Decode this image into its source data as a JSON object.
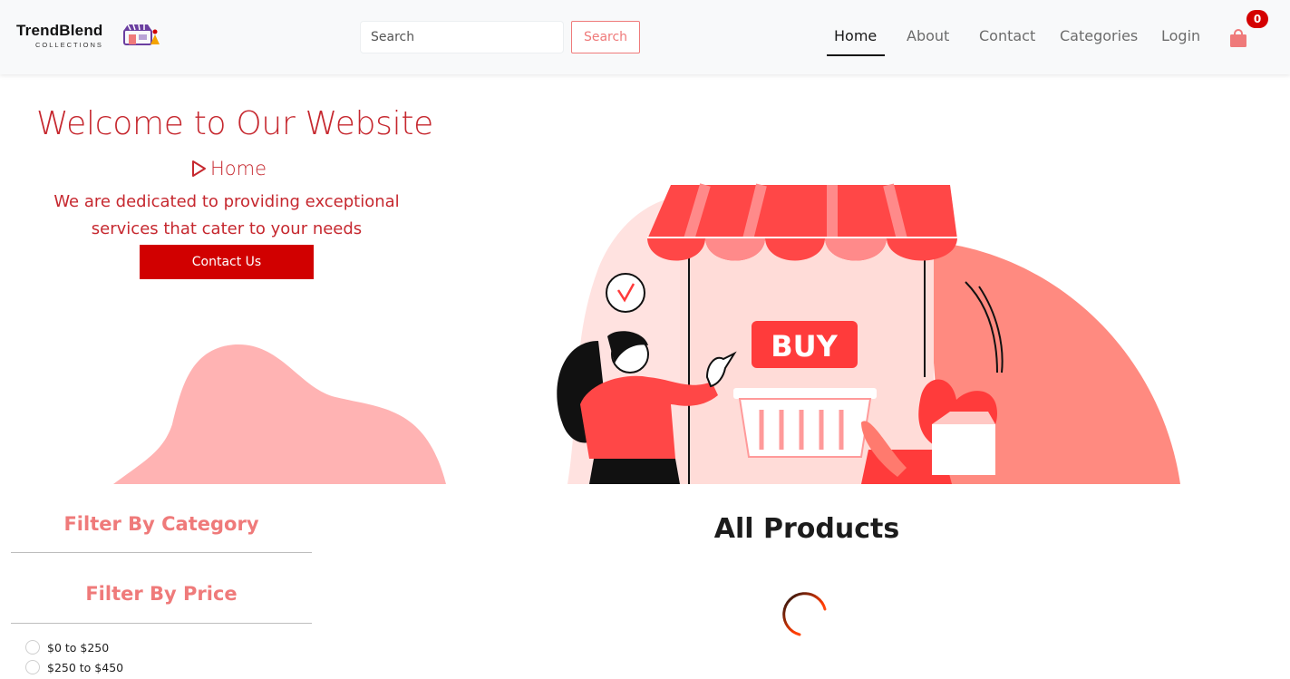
{
  "brand": {
    "name": "TrendBlend",
    "subtitle": "COLLECTIONS",
    "logo_icon": "storefront-icon"
  },
  "search": {
    "placeholder": "Search",
    "button_label": "Search"
  },
  "nav": {
    "items": [
      {
        "label": "Home",
        "active": true
      },
      {
        "label": "About",
        "active": false
      },
      {
        "label": "Contact",
        "active": false
      },
      {
        "label": "Categories",
        "active": false
      },
      {
        "label": "Login",
        "active": false
      }
    ],
    "cart": {
      "icon": "shopping-bag-icon",
      "count": "0"
    }
  },
  "hero": {
    "title": "Welcome to Our Website",
    "breadcrumb_icon": "play-outline-icon",
    "breadcrumb": "Home",
    "description": "We are dedicated to providing exceptional services that cater to your needs",
    "cta_label": "Contact Us",
    "sign_text": "BUY"
  },
  "filters": {
    "category_title": "Filter By Category",
    "price_title": "Filter By Price",
    "price_options": [
      "$0 to $250",
      "$250 to $450"
    ]
  },
  "products": {
    "title": "All Products",
    "loading_icon": "spinner-icon"
  },
  "colors": {
    "accent": "#c6282f",
    "button_red": "#d10000",
    "salmon": "#ef7a7a",
    "awning_red": "#ff4747",
    "blob_pink": "#ffb3b3",
    "badge": "#d40000"
  }
}
